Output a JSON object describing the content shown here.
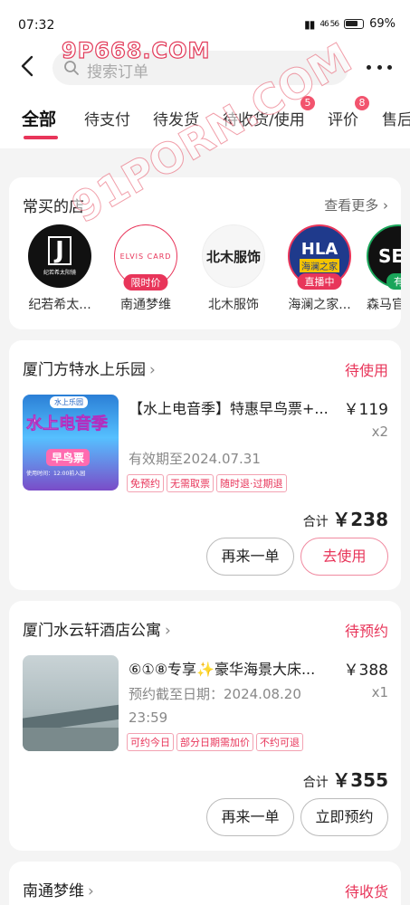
{
  "status_bar": {
    "time": "07:32",
    "network": "46 56",
    "battery": "69%"
  },
  "header": {
    "search_placeholder": "搜索订单",
    "watermark": "9P668.COM"
  },
  "page_watermark": "91PORN.COM",
  "tabs": [
    {
      "label": "全部",
      "active": true
    },
    {
      "label": "待支付"
    },
    {
      "label": "待发货"
    },
    {
      "label": "待收货/使用",
      "badge": "5"
    },
    {
      "label": "评价",
      "badge": "8"
    },
    {
      "label": "售后"
    }
  ],
  "frequent_shops": {
    "title": "常买的店",
    "see_more": "查看更多",
    "shops": [
      {
        "name": "纪若希太...",
        "logo_text": "J",
        "logo_sub": "纪若希太阳镜"
      },
      {
        "name": "南通梦维",
        "logo_text": "ELVIS CARD",
        "tag": "限时价"
      },
      {
        "name": "北木服饰",
        "logo_text": "北木服饰"
      },
      {
        "name": "海澜之家...",
        "logo_text": "HLA",
        "logo_sub": "海澜之家",
        "tag": "直播中"
      },
      {
        "name": "森马官",
        "logo_text": "SE",
        "tag": "有"
      }
    ]
  },
  "orders": [
    {
      "shop": "厦门方特水上乐园",
      "status": "待使用",
      "product": "【水上电音季】特惠早鸟票+...",
      "image_text": {
        "top": "水上乐园",
        "main": "水上电音季",
        "badge": "早鸟票",
        "footer": "使用时间：12:00前入园"
      },
      "price": "￥119",
      "qty": "x2",
      "info": [
        "有效期至2024.07.31"
      ],
      "tags": [
        "免预约",
        "无需取票",
        "随时退·过期退"
      ],
      "total_label": "合计",
      "total": "￥238",
      "buttons": [
        "再来一单",
        "去使用"
      ]
    },
    {
      "shop": "厦门水云轩酒店公寓",
      "status": "待预约",
      "product": "⑥①⑧专享✨豪华海景大床...",
      "price": "￥388",
      "qty": "x1",
      "info": [
        "预约截至日期：2024.08.20",
        "23:59"
      ],
      "tags": [
        "可约今日",
        "部分日期需加价",
        "不约可退"
      ],
      "total_label": "合计",
      "total": "￥355",
      "buttons": [
        "再来一单",
        "立即预约"
      ]
    },
    {
      "shop": "南通梦维",
      "status": "待收货"
    }
  ],
  "colors": {
    "accent": "#e8355a",
    "background": "#f4f4f4"
  }
}
